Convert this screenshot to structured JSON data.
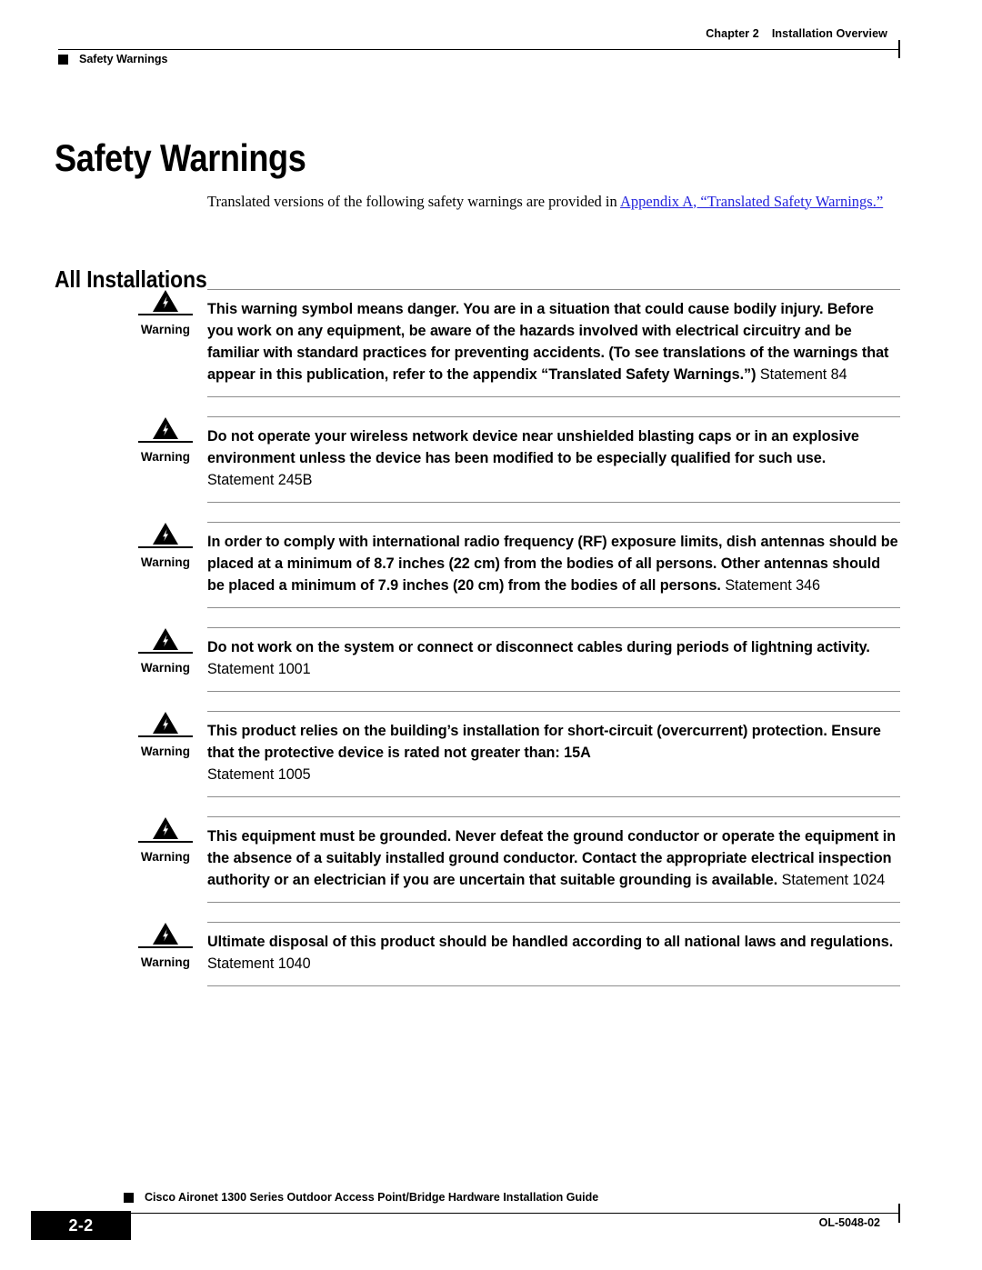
{
  "header": {
    "chapter_number": "Chapter 2",
    "chapter_title": "Installation Overview",
    "topic": "Safety Warnings"
  },
  "page": {
    "title": "Safety Warnings",
    "intro_before_link": "Translated versions of the following safety warnings are provided in ",
    "intro_link": "Appendix A, “Translated Safety Warnings.”",
    "section_heading": "All Installations"
  },
  "colors": {
    "link": "#2222dd",
    "rule": "#8d8d8d",
    "text": "#000000"
  },
  "warnings": [
    {
      "label": "Warning",
      "icon": "warning-triangle-lightning-icon",
      "text": "This warning symbol means danger. You are in a situation that could cause bodily injury. Before you work on any equipment, be aware of the hazards involved with electrical circuitry and be familiar with standard practices for preventing accidents. (To see translations of the warnings that appear in this publication, refer to the appendix “Translated Safety Warnings.”)",
      "statement": "Statement 84",
      "statement_inline": true
    },
    {
      "label": "Warning",
      "icon": "warning-triangle-lightning-icon",
      "text": "Do not operate your wireless network device near unshielded blasting caps or in an explosive environment unless the device has been modified to be especially qualified for such use.",
      "statement": "Statement 245B",
      "statement_inline": false
    },
    {
      "label": "Warning",
      "icon": "warning-triangle-lightning-icon",
      "text": "In order to comply with international radio frequency (RF) exposure limits, dish antennas should be placed at a minimum of 8.7 inches (22 cm) from the bodies of all persons. Other antennas should be placed a minimum of 7.9 inches (20 cm) from the bodies of all persons.",
      "statement": "Statement 346",
      "statement_inline": true
    },
    {
      "label": "Warning",
      "icon": "warning-triangle-lightning-icon",
      "text": "Do not work on the system or connect or disconnect cables during periods of lightning activity.",
      "statement": "Statement 1001",
      "statement_inline": false
    },
    {
      "label": "Warning",
      "icon": "warning-triangle-lightning-icon",
      "text": "This product relies on the building’s installation for short-circuit (overcurrent) protection. Ensure that the protective device is rated not greater than: 15A",
      "statement": "Statement 1005",
      "statement_inline": false
    },
    {
      "label": "Warning",
      "icon": "warning-triangle-lightning-icon",
      "text": "This equipment must be grounded. Never defeat the ground conductor or operate the equipment in the absence of a suitably installed ground conductor. Contact the appropriate electrical inspection authority or an electrician if you are uncertain that suitable grounding is available.",
      "statement": "Statement 1024",
      "statement_inline": true
    },
    {
      "label": "Warning",
      "icon": "warning-triangle-lightning-icon",
      "text": "Ultimate disposal of this product should be handled according to all national laws and regulations.",
      "statement": "Statement 1040",
      "statement_inline": false
    }
  ],
  "footer": {
    "page_number": "2-2",
    "guide_title": "Cisco Aironet 1300 Series Outdoor Access Point/Bridge Hardware Installation Guide",
    "doc_id": "OL-5048-02"
  }
}
